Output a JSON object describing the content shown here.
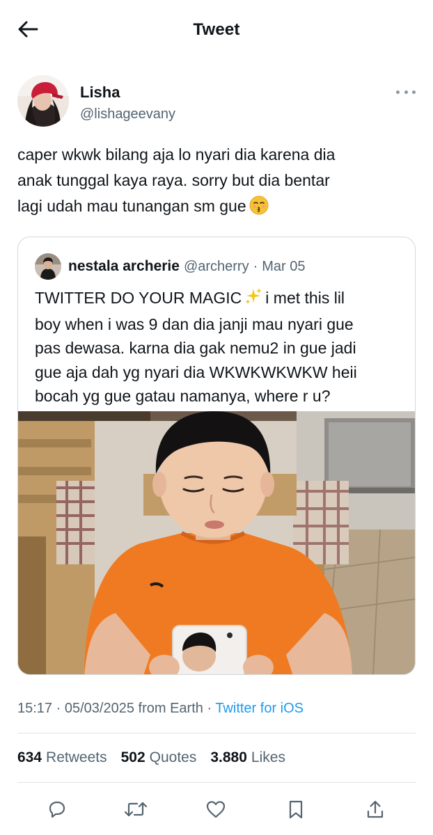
{
  "header": {
    "title": "Tweet"
  },
  "tweet": {
    "author": {
      "name": "Lisha",
      "handle": "@lishageevany"
    },
    "text_lines": [
      "caper wkwk bilang aja lo nyari dia karena dia",
      "anak tunggal kaya raya. sorry but dia bentar",
      "lagi udah mau tunangan sm gue"
    ],
    "emoji": "kissing-face"
  },
  "quoted": {
    "author_name": "nestala archerie",
    "handle": "@archerry",
    "separator": "·",
    "date": "Mar 05",
    "line1_before": "TWITTER DO YOUR MAGIC",
    "line1_after": "i met this lil",
    "lines": [
      "boy when i was 9 dan dia janji mau nyari gue",
      "pas dewasa. karna dia gak nemu2 in gue jadi",
      "gue aja dah yg nyari dia WKWKWKWKW heii",
      "bocah yg gue gatau namanya, where r u?"
    ],
    "emoji": "sparkles",
    "image_subject": "boy-in-orange-shirt-photo"
  },
  "meta": {
    "time": "15:17",
    "separator": "·",
    "date": "05/03/2025 from Earth",
    "source": "Twitter for iOS"
  },
  "stats": {
    "retweets_count": "634",
    "retweets_label": "Retweets",
    "quotes_count": "502",
    "quotes_label": "Quotes",
    "likes_count": "3.880",
    "likes_label": "Likes"
  },
  "actions": [
    "reply-icon",
    "retweet-icon",
    "like-icon",
    "bookmark-icon",
    "share-icon"
  ],
  "colors": {
    "link": "#1d9bf0",
    "secondary_text": "#536471",
    "icon": "#536471",
    "border": "#cfd9de"
  }
}
